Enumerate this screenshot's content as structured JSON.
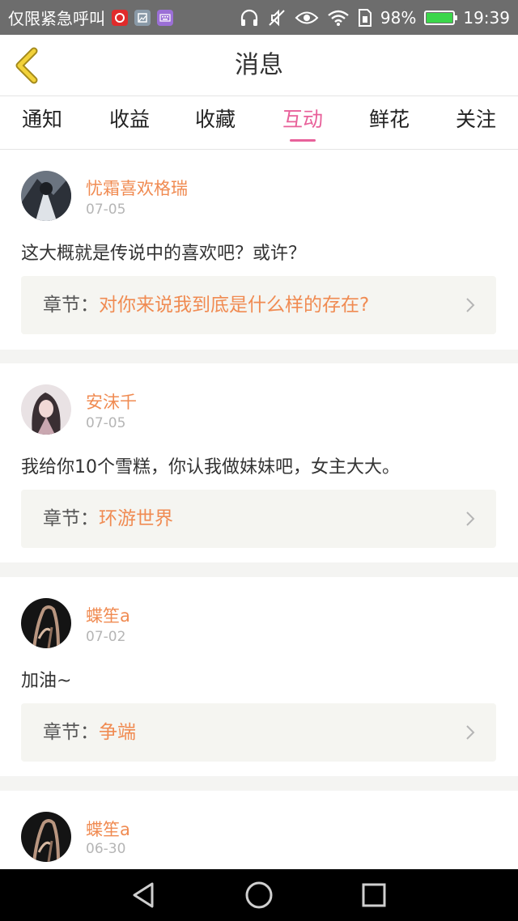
{
  "status_bar": {
    "carrier_text": "仅限紧急呼叫",
    "battery_percent": "98%",
    "time": "19:39",
    "icons": [
      "netease-music-icon",
      "gallery-icon",
      "keyboard-icon",
      "headphones-icon",
      "mute-icon",
      "eye-icon",
      "wifi-icon",
      "sim-icon",
      "battery-icon"
    ]
  },
  "header": {
    "title": "消息",
    "back_icon": "chevron-left-icon"
  },
  "tabs": [
    {
      "label": "通知"
    },
    {
      "label": "收益"
    },
    {
      "label": "收藏"
    },
    {
      "label": "互动",
      "active": true
    },
    {
      "label": "鲜花"
    },
    {
      "label": "关注"
    }
  ],
  "messages": [
    {
      "username": "忧霜喜欢格瑞",
      "date": "07-05",
      "text": "这大概就是传说中的喜欢吧？或许？",
      "chapter_label": "章节：",
      "chapter_title": "对你来说我到底是什么样的存在?"
    },
    {
      "username": "安沫千",
      "date": "07-05",
      "text": "我给你10个雪糕，你认我做妹妹吧，女主大大。",
      "chapter_label": "章节：",
      "chapter_title": "环游世界"
    },
    {
      "username": "蝶笙a",
      "date": "07-02",
      "text": "加油~",
      "chapter_label": "章节：",
      "chapter_title": "争端"
    },
    {
      "username": "蝶笙a",
      "date": "06-30"
    }
  ],
  "colors": {
    "accent": "#e8619a",
    "name_orange": "#f08b52",
    "status_bar": "#6d6d6d"
  },
  "nav_bar": {
    "icons": [
      "back-triangle-icon",
      "home-circle-icon",
      "recents-square-icon"
    ]
  }
}
